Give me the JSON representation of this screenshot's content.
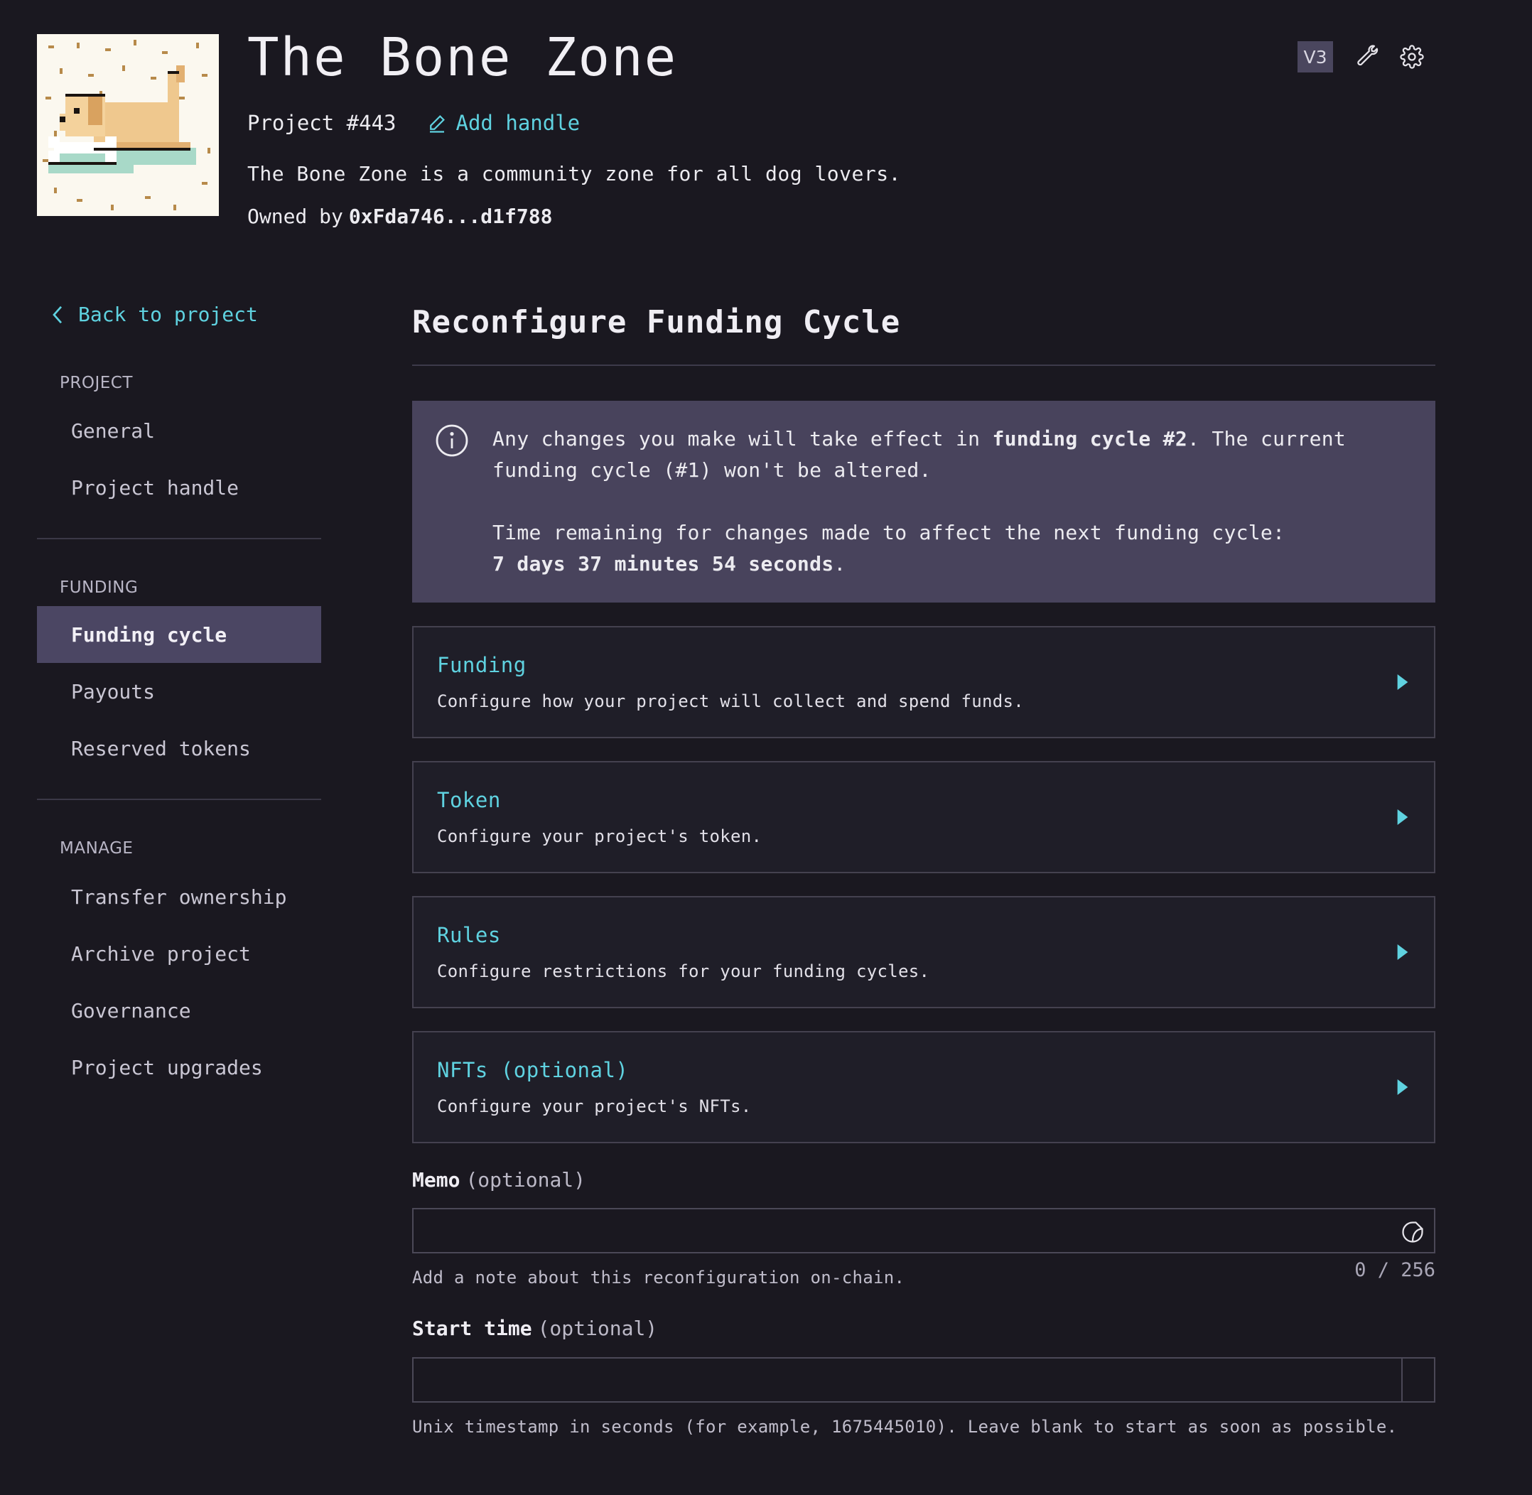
{
  "project": {
    "name": "The Bone Zone",
    "id_label": "Project #443",
    "add_handle_label": "Add handle",
    "description": "The Bone Zone is a community zone for all dog lovers.",
    "owner_prefix": "Owned by",
    "owner_address": "0xFda746...d1f788",
    "version_badge": "V3"
  },
  "sidebar": {
    "back_label": "Back to project",
    "sections": [
      {
        "label": "PROJECT",
        "items": [
          "General",
          "Project handle"
        ]
      },
      {
        "label": "FUNDING",
        "items": [
          "Funding cycle",
          "Payouts",
          "Reserved tokens"
        ],
        "active": "Funding cycle"
      },
      {
        "label": "MANAGE",
        "items": [
          "Transfer ownership",
          "Archive project",
          "Governance",
          "Project upgrades"
        ]
      }
    ]
  },
  "main": {
    "title": "Reconfigure Funding Cycle",
    "notice": {
      "line1_pre": "Any changes you make will take effect in ",
      "line1_bold": "funding cycle #2",
      "line1_post": ". The current funding cycle (#1) won't be altered.",
      "line2": "Time remaining for changes made to affect the next funding cycle:",
      "countdown": "7 days 37 minutes 54 seconds",
      "countdown_suffix": "."
    },
    "panels": [
      {
        "title": "Funding",
        "description": "Configure how your project will collect and spend funds."
      },
      {
        "title": "Token",
        "description": "Configure your project's token."
      },
      {
        "title": "Rules",
        "description": "Configure restrictions for your funding cycles."
      },
      {
        "title": "NFTs (optional)",
        "description": "Configure your project's NFTs."
      }
    ],
    "memo": {
      "label": "Memo",
      "optional": "(optional)",
      "value": "",
      "helper": "Add a note about this reconfiguration on-chain.",
      "count": "0 / 256"
    },
    "start_time": {
      "label": "Start time",
      "optional": "(optional)",
      "value": "",
      "helper": "Unix timestamp in seconds (for example, 1675445010). Leave blank to start as soon as possible."
    }
  },
  "colors": {
    "background": "#1a1820",
    "accent": "#5fd2e0",
    "active_nav": "#4b4663",
    "notice_bg": "#48435c"
  }
}
